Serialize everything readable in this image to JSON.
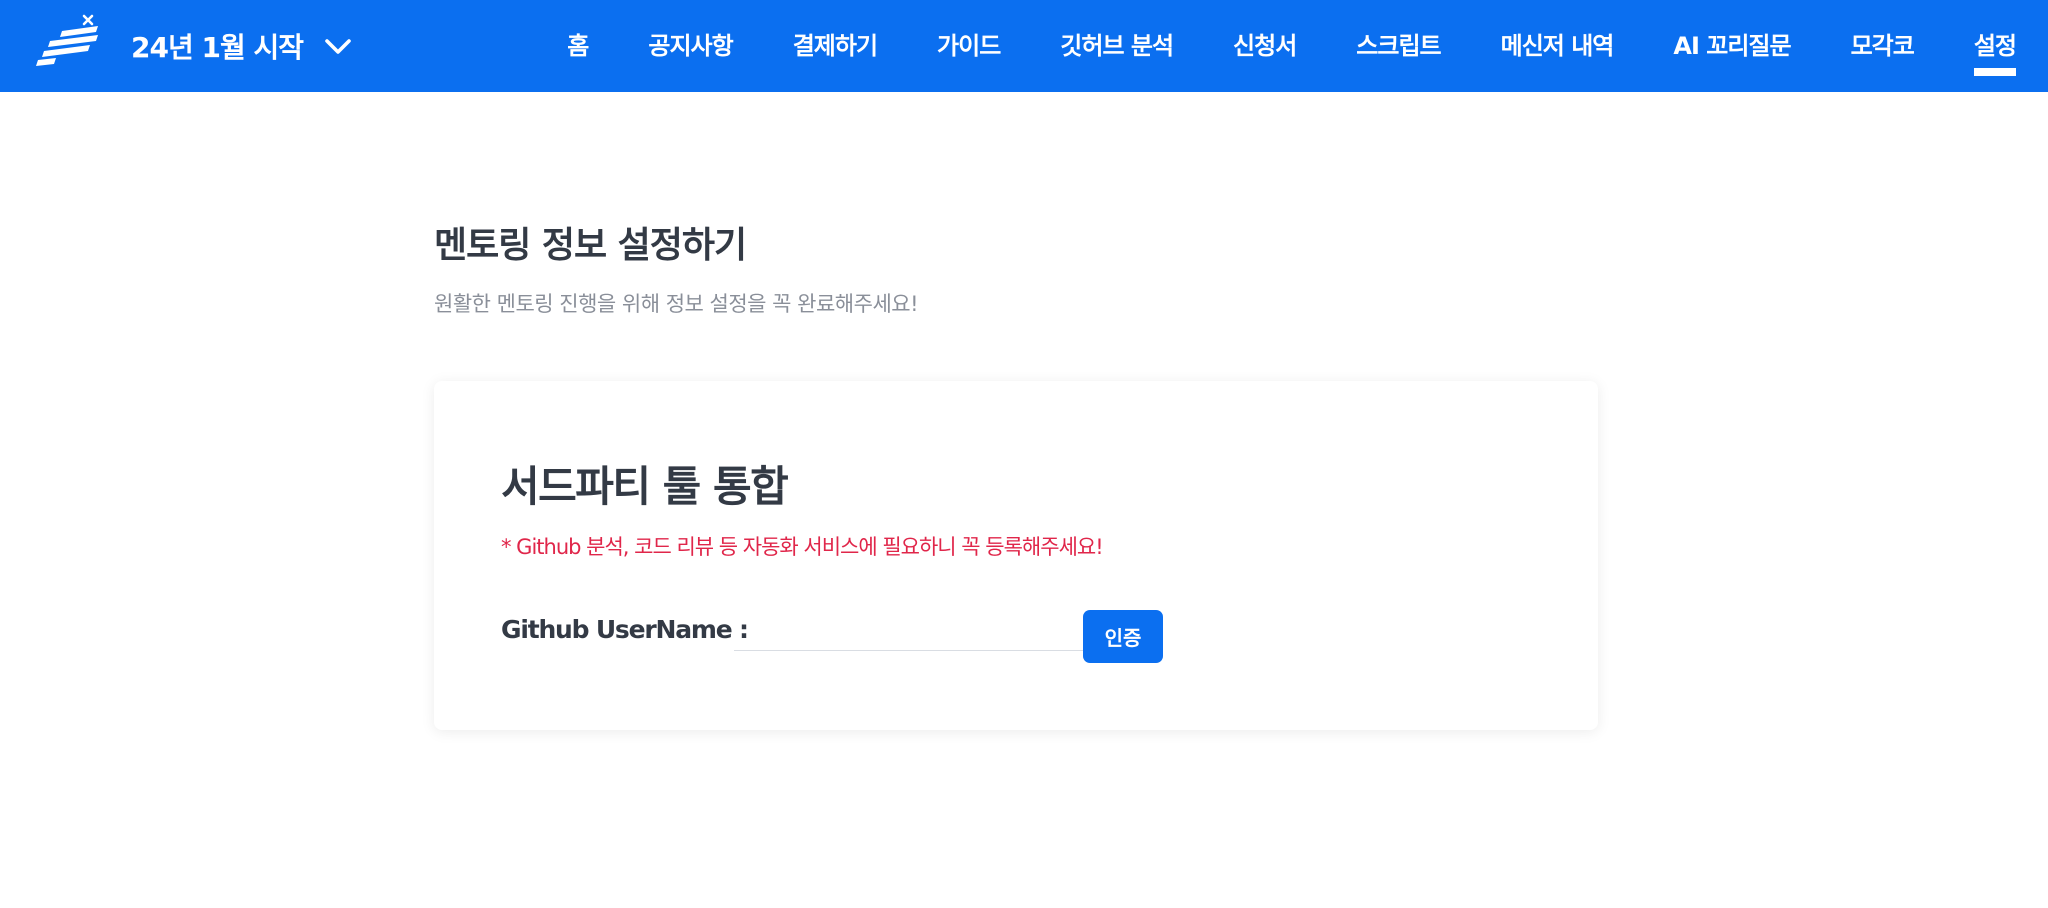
{
  "header": {
    "logo_icon": "flag-logo-icon",
    "cohort_label": "24년 1월 시작",
    "cohort_dropdown_icon": "chevron-down-icon",
    "nav": [
      {
        "label": "홈",
        "active": false
      },
      {
        "label": "공지사항",
        "active": false
      },
      {
        "label": "결제하기",
        "active": false
      },
      {
        "label": "가이드",
        "active": false
      },
      {
        "label": "깃허브 분석",
        "active": false
      },
      {
        "label": "신청서",
        "active": false
      },
      {
        "label": "스크립트",
        "active": false
      },
      {
        "label": "메신저 내역",
        "active": false
      },
      {
        "label": "AI 꼬리질문",
        "active": false
      },
      {
        "label": "모각코",
        "active": false
      },
      {
        "label": "설정",
        "active": true
      }
    ]
  },
  "main": {
    "title": "멘토링 정보 설정하기",
    "subtitle": "원활한 멘토링 진행을 위해 정보 설정을 꼭 완료해주세요!",
    "card": {
      "title": "서드파티 툴 통합",
      "note": "* Github 분석, 코드 리뷰 등 자동화 서비스에 필요하니 꼭 등록해주세요!",
      "field_label": "Github UserName :",
      "input_value": "",
      "input_placeholder": "",
      "button_label": "인증"
    }
  },
  "colors": {
    "brand": "#0b6ff0",
    "warning": "#e0264a",
    "heading": "#333a45",
    "muted": "#8a8f99"
  }
}
